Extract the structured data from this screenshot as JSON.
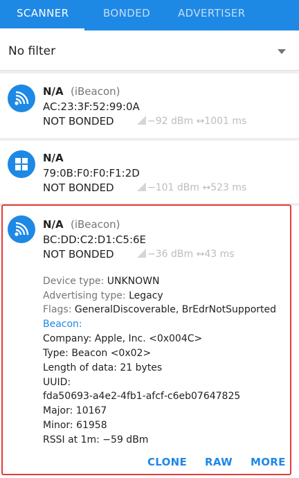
{
  "tabs": [
    "SCANNER",
    "BONDED",
    "ADVERTISER"
  ],
  "filter": {
    "value": "No filter"
  },
  "devices": [
    {
      "name": "N/A",
      "type": "(iBeacon)",
      "address": "AC:23:3F:52:99:0A",
      "bond": "NOT BONDED",
      "rssi": "−92 dBm",
      "interval": "1001 ms",
      "icon": "beacon-icon"
    },
    {
      "name": "N/A",
      "type": "",
      "address": "79:0B:F0:F0:F1:2D",
      "bond": "NOT BONDED",
      "rssi": "−101 dBm",
      "interval": "523 ms",
      "icon": "windows-icon"
    },
    {
      "name": "N/A",
      "type": "(iBeacon)",
      "address": "BC:DD:C2:D1:C5:6E",
      "bond": "NOT BONDED",
      "rssi": "−36 dBm",
      "interval": "43 ms",
      "icon": "beacon-icon"
    }
  ],
  "details": {
    "device_type_label": "Device type:",
    "device_type_value": "UNKNOWN",
    "adv_type_label": "Advertising type:",
    "adv_type_value": "Legacy",
    "flags_label": "Flags:",
    "flags_value": "GeneralDiscoverable, BrEdrNotSupported",
    "beacon_title": "Beacon:",
    "company": "Company: Apple, Inc. <0x004C>",
    "type": "Type: Beacon <0x02>",
    "length": "Length of data: 21 bytes",
    "uuid_label": "UUID:",
    "uuid": "fda50693‑a4e2‑4fb1‑afcf‑c6eb07647825",
    "major": "Major: 10167",
    "minor": "Minor: 61958",
    "rssi1m": "RSSI at 1m: −59 dBm"
  },
  "actions": [
    "CLONE",
    "RAW",
    "MORE"
  ],
  "colors": {
    "primary": "#1e88e5",
    "highlight": "#e53935"
  }
}
